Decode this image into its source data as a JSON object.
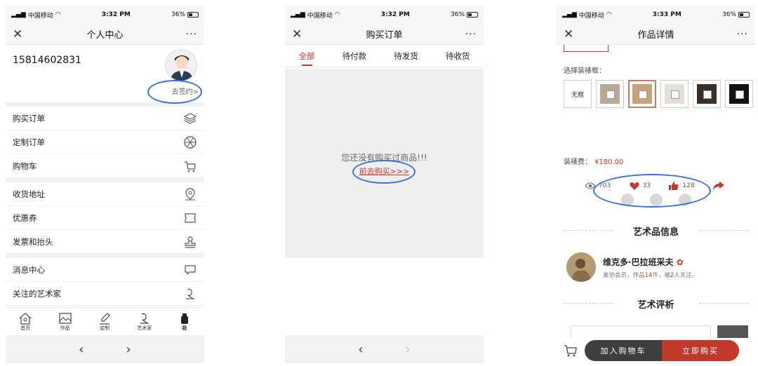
{
  "status_bars": [
    {
      "carrier": "中国移动",
      "time": "3:32 PM",
      "battery": "36%"
    },
    {
      "carrier": "中国移动",
      "time": "3:32 PM",
      "battery": "36%"
    },
    {
      "carrier": "中国移动",
      "time": "3:33 PM",
      "battery": "36%"
    }
  ],
  "nav": {
    "close": "✕",
    "more": "···",
    "titles": [
      "个人中心",
      "购买订单",
      "作品详情"
    ]
  },
  "profile": {
    "phone": "15814602831",
    "sign_link": "去签约>"
  },
  "menu": {
    "items": [
      "购买订单",
      "定制订单",
      "购物车",
      "收货地址",
      "优惠券",
      "发票和抬头",
      "消息中心",
      "关注的艺术家"
    ]
  },
  "tabbar": {
    "items": [
      "首页",
      "作品",
      "定制",
      "艺术家",
      "我"
    ]
  },
  "browser": {
    "back": "‹",
    "forward": "›"
  },
  "orders": {
    "tabs": [
      "全部",
      "待付款",
      "待发货",
      "待收货"
    ],
    "empty_text": "您还没有购买过商品!!!",
    "go_buy": "前去购买>>>"
  },
  "detail": {
    "frame_label": "选择装裱框：",
    "no_frame": "无框",
    "fee_label": "装裱费：",
    "fee_value": "¥180.00",
    "views": "703",
    "likes": "33",
    "thumbs": "128",
    "section_art_info": "艺术品信息",
    "artist_name": "维克多·巴拉班采夫",
    "artist_sub_prefix": "美协会员，作品",
    "artist_works": "14",
    "artist_sub_mid": "件，被",
    "artist_follow": "2",
    "artist_sub_suffix": "人关注。",
    "section_review": "艺术评析",
    "add_cart": "加入购物车",
    "buy_now": "立即购买"
  },
  "colors": {
    "accent": "#c0392b",
    "highlight_oval": "#3a6fd8"
  }
}
